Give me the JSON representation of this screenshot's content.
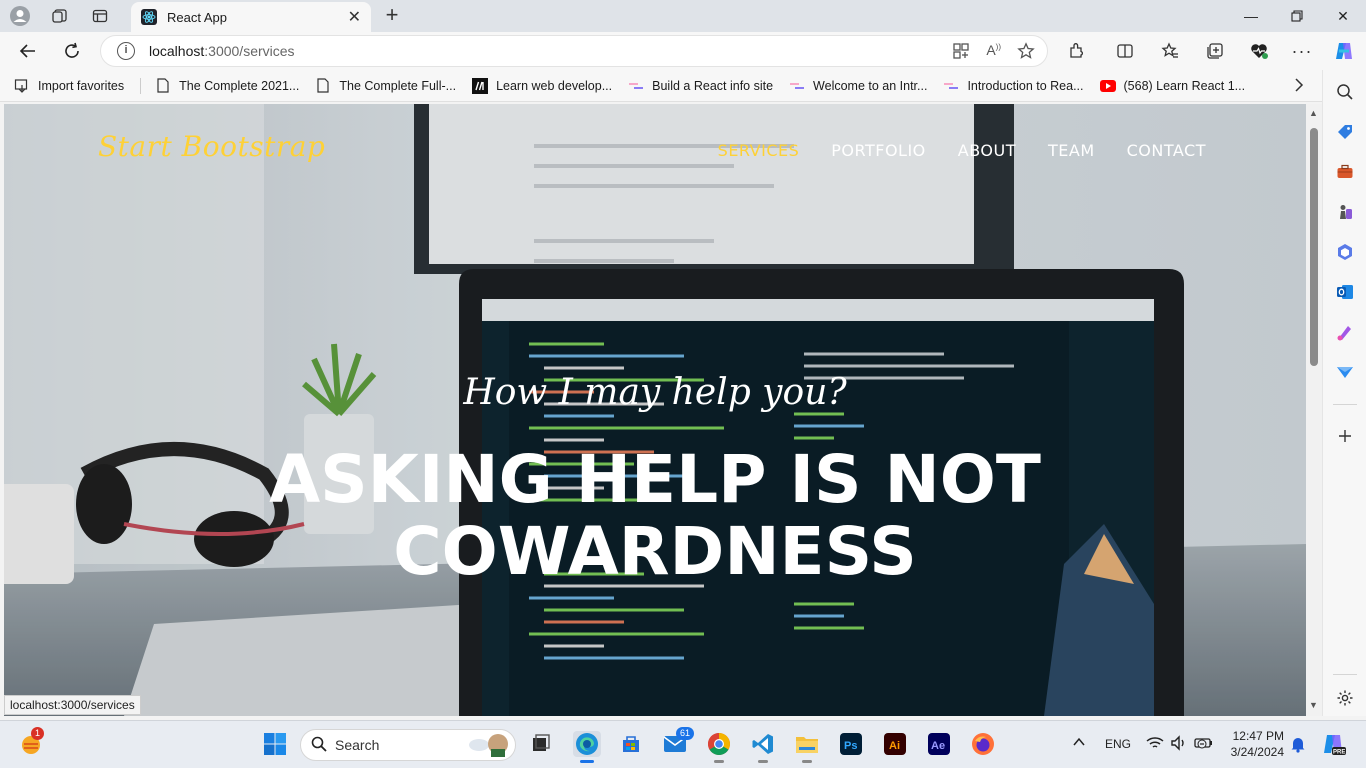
{
  "browser": {
    "tab_title": "React App",
    "url_host": "localhost",
    "url_path": ":3000/services",
    "status_url": "localhost:3000/services"
  },
  "favorites": [
    {
      "label": "Import favorites",
      "icon": "import-icon"
    },
    {
      "label": "The Complete 2021...",
      "icon": "page-icon"
    },
    {
      "label": "The Complete Full-...",
      "icon": "page-icon"
    },
    {
      "label": "Learn web develop...",
      "icon": "mdn-icon"
    },
    {
      "label": "Build a React info site",
      "icon": "scrimba-icon"
    },
    {
      "label": "Welcome to an Intr...",
      "icon": "scrimba-icon"
    },
    {
      "label": "Introduction to Rea...",
      "icon": "scrimba-icon"
    },
    {
      "label": "(568) Learn React 1...",
      "icon": "youtube-icon"
    }
  ],
  "site": {
    "brand": "Start Bootstrap",
    "nav": [
      {
        "label": "SERVICES",
        "active": true
      },
      {
        "label": "PORTFOLIO",
        "active": false
      },
      {
        "label": "ABOUT",
        "active": false
      },
      {
        "label": "TEAM",
        "active": false
      },
      {
        "label": "CONTACT",
        "active": false
      }
    ],
    "hero_subheading": "How I may help you?",
    "hero_heading": "ASKING HELP IS NOT COWARDNESS",
    "accent_color": "#fed136"
  },
  "taskbar": {
    "search_label": "Search",
    "mail_badge": "61",
    "notification_badge": "1",
    "language": "ENG",
    "time": "12:47 PM",
    "date": "3/24/2024"
  }
}
